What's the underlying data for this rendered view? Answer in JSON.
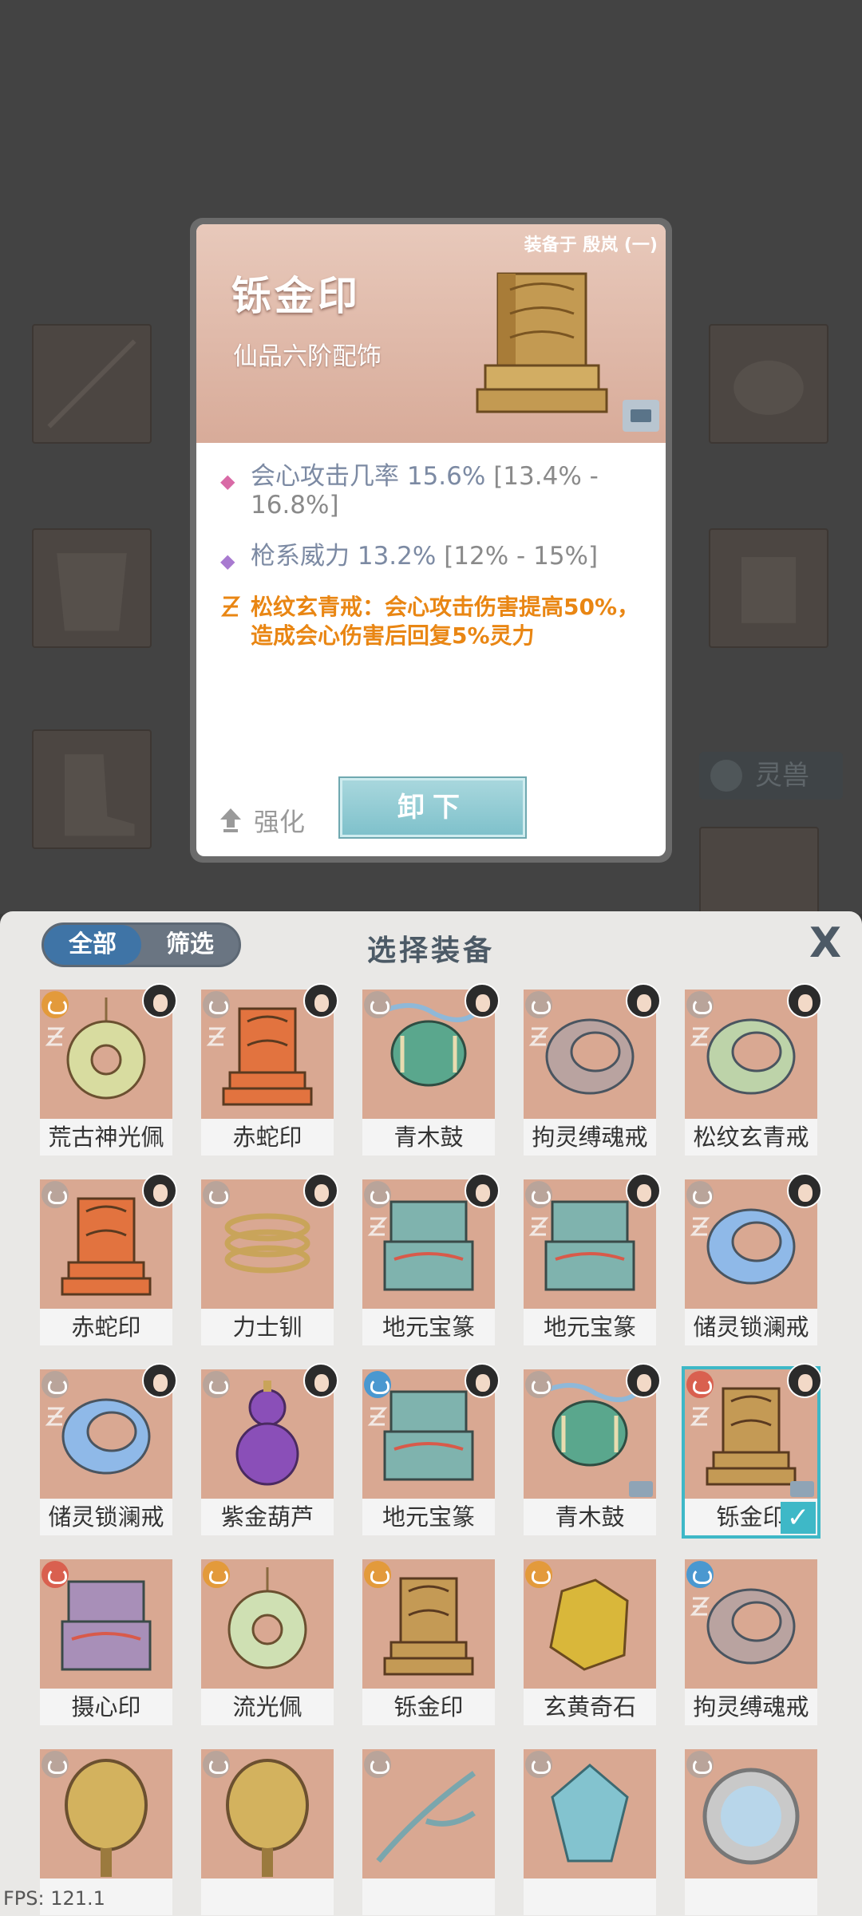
{
  "detail": {
    "equipped_on": "装备于 殷岚 (一)",
    "name": "铄金印",
    "grade": "仙品六阶配饰",
    "stats": [
      {
        "label": "会心攻击几率 15.6%",
        "range": "[13.4% - 16.8%]",
        "bullet": "◆",
        "bullet_color": "#d96aa6"
      },
      {
        "label": "枪系威力 13.2%",
        "range": "[12% - 15%]",
        "bullet": "◆",
        "bullet_color": "#a87ad0"
      }
    ],
    "set_bonus": "松纹玄青戒：会心攻击伤害提高50%，造成会心伤害后回复5%灵力",
    "upgrade_label": "强化",
    "unload_label": "卸下"
  },
  "background": {
    "pet_label": "灵兽"
  },
  "panel": {
    "tabs": [
      "全部",
      "筛选"
    ],
    "title": "选择装备",
    "close_label": "X"
  },
  "items": [
    {
      "name": "荒古神光佩",
      "element": "fire",
      "set": true,
      "owner": true,
      "art": "pendant",
      "color": "#d8dca0"
    },
    {
      "name": "赤蛇印",
      "element": "neutral",
      "set": true,
      "owner": true,
      "art": "seal",
      "color": "#e2733f"
    },
    {
      "name": "青木鼓",
      "element": "neutral",
      "set": false,
      "owner": true,
      "art": "drum",
      "color": "#5aa78d"
    },
    {
      "name": "拘灵缚魂戒",
      "element": "neutral",
      "set": true,
      "owner": true,
      "art": "ring",
      "color": "#b9a3a0"
    },
    {
      "name": "松纹玄青戒",
      "element": "neutral",
      "set": true,
      "owner": true,
      "art": "ring",
      "color": "#bdd3a9"
    },
    {
      "name": "赤蛇印",
      "element": "neutral",
      "set": false,
      "owner": true,
      "art": "seal",
      "color": "#e2733f"
    },
    {
      "name": "力士钏",
      "element": "neutral",
      "set": false,
      "owner": true,
      "art": "coil",
      "color": "#c9a45a"
    },
    {
      "name": "地元宝篆",
      "element": "neutral",
      "set": true,
      "owner": true,
      "art": "box",
      "color": "#7fb3ae"
    },
    {
      "name": "地元宝篆",
      "element": "neutral",
      "set": true,
      "owner": true,
      "art": "box",
      "color": "#7fb3ae"
    },
    {
      "name": "储灵锁澜戒",
      "element": "neutral",
      "set": true,
      "owner": true,
      "art": "ring",
      "color": "#8fb9e8"
    },
    {
      "name": "储灵锁澜戒",
      "element": "neutral",
      "set": true,
      "owner": true,
      "art": "ring",
      "color": "#8fb9e8"
    },
    {
      "name": "紫金葫芦",
      "element": "neutral",
      "set": false,
      "owner": true,
      "art": "gourd",
      "color": "#8a4fb8"
    },
    {
      "name": "地元宝篆",
      "element": "water",
      "set": true,
      "owner": true,
      "art": "box",
      "color": "#7fb3ae"
    },
    {
      "name": "青木鼓",
      "element": "neutral",
      "set": false,
      "owner": true,
      "art": "drum",
      "color": "#5aa78d",
      "equipped": true
    },
    {
      "name": "铄金印",
      "element": "red",
      "set": true,
      "owner": true,
      "art": "seal",
      "color": "#c49a55",
      "equipped": true,
      "selected": true
    },
    {
      "name": "摄心印",
      "element": "red",
      "set": false,
      "owner": false,
      "art": "box",
      "color": "#a88fb8"
    },
    {
      "name": "流光佩",
      "element": "fire",
      "set": false,
      "owner": false,
      "art": "pendant",
      "color": "#cfe0b3"
    },
    {
      "name": "铄金印",
      "element": "fire",
      "set": false,
      "owner": false,
      "art": "seal",
      "color": "#c49a55"
    },
    {
      "name": "玄黄奇石",
      "element": "fire",
      "set": false,
      "owner": false,
      "art": "stone",
      "color": "#d9b73a"
    },
    {
      "name": "拘灵缚魂戒",
      "element": "water",
      "set": true,
      "owner": false,
      "art": "ring",
      "color": "#b9a3a0"
    },
    {
      "name": "",
      "element": "neutral",
      "set": false,
      "owner": false,
      "art": "mirror",
      "color": "#d3b25e"
    },
    {
      "name": "",
      "element": "neutral",
      "set": false,
      "owner": false,
      "art": "mirror",
      "color": "#d3b25e"
    },
    {
      "name": "",
      "element": "neutral",
      "set": false,
      "owner": false,
      "art": "branch",
      "color": "#7aa6ad"
    },
    {
      "name": "",
      "element": "neutral",
      "set": false,
      "owner": false,
      "art": "crest",
      "color": "#83c3cf"
    },
    {
      "name": "",
      "element": "neutral",
      "set": false,
      "owner": false,
      "art": "mirror-round",
      "color": "#b8d6ea"
    }
  ],
  "fps": "FPS: 121.1"
}
